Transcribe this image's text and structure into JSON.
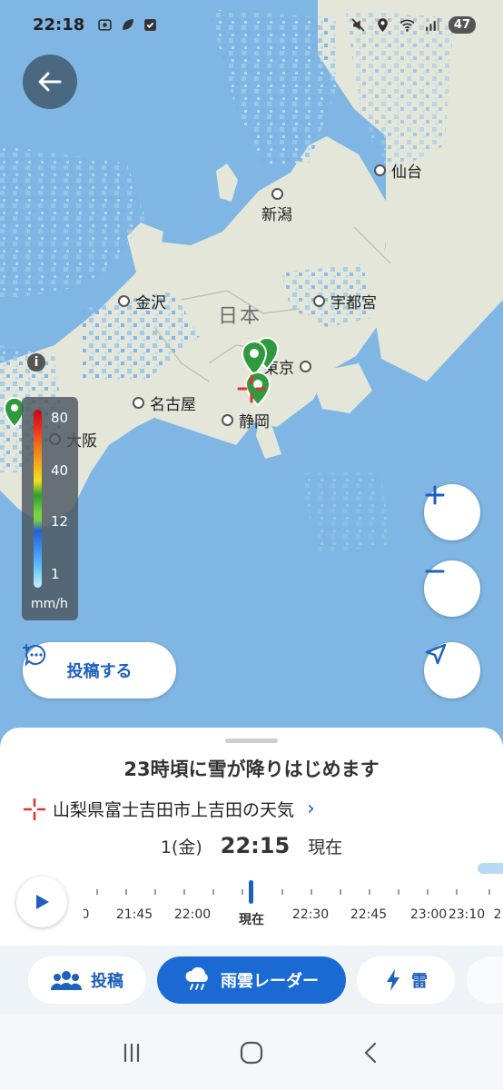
{
  "status_bar": {
    "time": "22:18",
    "battery": "47",
    "left_icons": [
      "screenshot-icon",
      "leaf-icon",
      "checkbox-icon"
    ],
    "right_icons": [
      "mute-icon",
      "location-icon",
      "wifi-icon",
      "signal-icon"
    ]
  },
  "map": {
    "country_label": "日本",
    "cities": [
      {
        "name": "仙台"
      },
      {
        "name": "新潟"
      },
      {
        "name": "宇都宮"
      },
      {
        "name": "金沢"
      },
      {
        "name": "東京"
      },
      {
        "name": "名古屋"
      },
      {
        "name": "静岡"
      },
      {
        "name": "大阪"
      }
    ],
    "legend": {
      "ticks": [
        "80",
        "40",
        "12",
        "1"
      ],
      "unit": "mm/h"
    },
    "post_button_label": "投稿する"
  },
  "sheet": {
    "forecast_title": "23時頃に雪が降りはじめます",
    "location": "山梨県富士吉田市上吉田の天気",
    "date": "1(金)",
    "clock": "22:15",
    "now_label": "現在",
    "timeline_labels": [
      "0",
      "21:45",
      "22:00",
      "現在",
      "22:30",
      "22:45",
      "23:00",
      "23:10",
      "2"
    ]
  },
  "tabs": [
    {
      "label": "投稿",
      "icon": "people-icon",
      "active": false
    },
    {
      "label": "雨雲レーダー",
      "icon": "rain-cloud-icon",
      "active": true
    },
    {
      "label": "雷",
      "icon": "lightning-icon",
      "active": false
    }
  ],
  "colors": {
    "accent": "#1b6ad4",
    "sea": "#7fb6e3",
    "land": "#e3e6da"
  }
}
